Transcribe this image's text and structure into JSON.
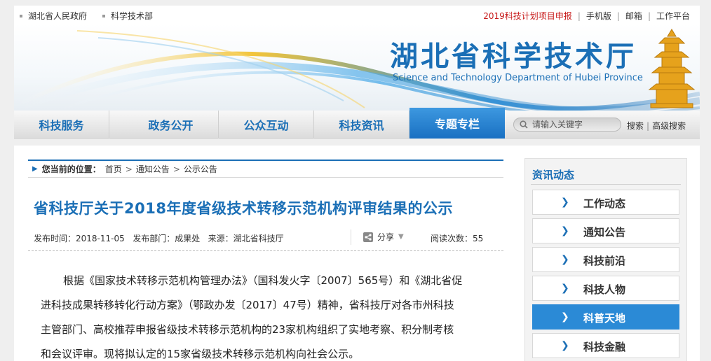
{
  "topbar": {
    "left_links": [
      "湖北省人民政府",
      "科学技术部"
    ],
    "right_links": [
      {
        "label": "2019科技计划项目申报",
        "highlight": true
      },
      {
        "label": "手机版",
        "highlight": false
      },
      {
        "label": "邮箱",
        "highlight": false
      },
      {
        "label": "工作平台",
        "highlight": false
      }
    ]
  },
  "banner": {
    "title_cn": "湖北省科学技术厅",
    "title_en": "Science and Technology Department of Hubei Province"
  },
  "nav": {
    "items": [
      {
        "label": "科技服务",
        "active": false
      },
      {
        "label": "政务公开",
        "active": false
      },
      {
        "label": "公众互动",
        "active": false
      },
      {
        "label": "科技资讯",
        "active": false
      },
      {
        "label": "专题专栏",
        "active": true
      }
    ],
    "search_placeholder": "请输入关键字",
    "search_label": "搜索",
    "advanced_label": "高级搜索"
  },
  "breadcrumb": {
    "label": "您当前的位置：",
    "items": [
      "首页",
      "通知公告",
      "公示公告"
    ]
  },
  "article": {
    "title": "省科技厅关于2018年度省级技术转移示范机构评审结果的公示",
    "meta": {
      "published": "发布时间：2018-11-05",
      "department": "发布部门：成果处",
      "source": "来源：湖北省科技厅",
      "share_label": "分享",
      "views": "阅读次数：55"
    },
    "lines": [
      "根据《国家技术转移示范机构管理办法》（国科发火字〔2007〕565号）和《湖北省促",
      "进科技成果转移转化行动方案》（鄂政办发〔2017〕47号）精神，省科技厅对各市州科技",
      "主管部门、高校推荐申报省级技术转移示范机构的23家机构组织了实地考察、积分制考核",
      "和会议评审。现将拟认定的15家省级技术转移示范机构向社会公示。"
    ]
  },
  "sidebar": {
    "title": "资讯动态",
    "items": [
      {
        "label": "工作动态",
        "active": false
      },
      {
        "label": "通知公告",
        "active": false
      },
      {
        "label": "科技前沿",
        "active": false
      },
      {
        "label": "科技人物",
        "active": false
      },
      {
        "label": "科普天地",
        "active": true
      },
      {
        "label": "科技金融",
        "active": false
      }
    ]
  },
  "colors": {
    "brand_blue": "#1b6fb6",
    "active_blue": "#2b8ad6",
    "hot_red": "#c71a1a"
  }
}
